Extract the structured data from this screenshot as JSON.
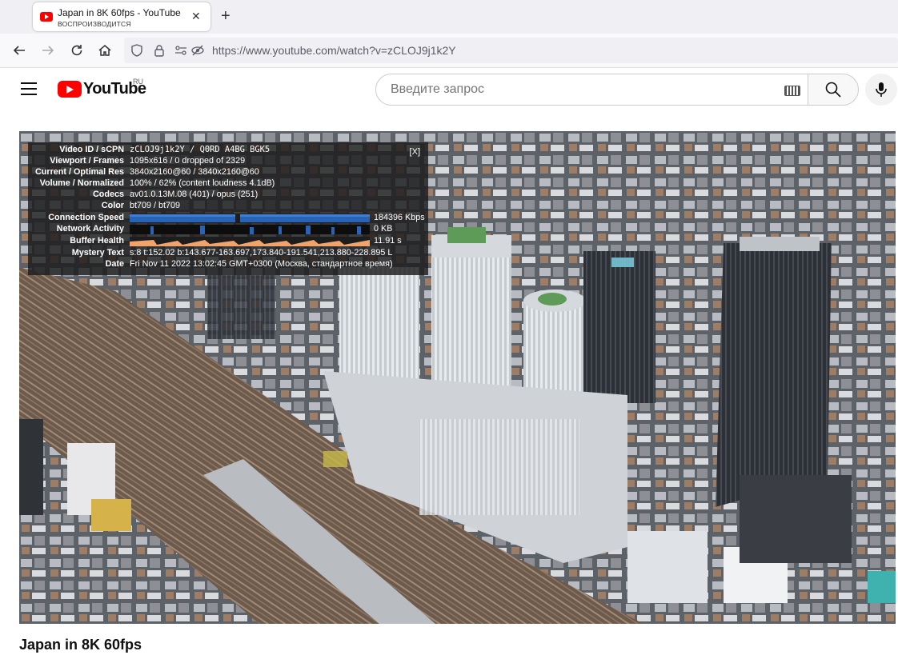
{
  "browser": {
    "tab_title": "Japan in 8K 60fps - YouTube",
    "tab_subtitle": "ВОСПРОИЗВОДИТСЯ",
    "url": "https://www.youtube.com/watch?v=zCLOJ9j1k2Y"
  },
  "youtube": {
    "logo_text": "YouTube",
    "country_code": "RU",
    "search_placeholder": "Введите запрос"
  },
  "stats": {
    "close_label": "[X]",
    "rows": [
      {
        "label": "Video ID / sCPN",
        "value": "zCLOJ9j1k2Y / Q0RD A4BG BGK5"
      },
      {
        "label": "Viewport / Frames",
        "value": "1095x616 / 0 dropped of 2329"
      },
      {
        "label": "Current / Optimal Res",
        "value": "3840x2160@60 / 3840x2160@60"
      },
      {
        "label": "Volume / Normalized",
        "value": "100% / 62% (content loudness 4.1dB)"
      },
      {
        "label": "Codecs",
        "value": "av01.0.13M.08 (401) / opus (251)"
      },
      {
        "label": "Color",
        "value": "bt709 / bt709"
      },
      {
        "label": "Connection Speed",
        "value": "184396 Kbps"
      },
      {
        "label": "Network Activity",
        "value": "0 KB"
      },
      {
        "label": "Buffer Health",
        "value": "11.91 s"
      },
      {
        "label": "Mystery Text",
        "value": "s:8 t:152.02 b:143.677-163.697,173.840-191.541,213.880-228.895 L"
      },
      {
        "label": "Date",
        "value": "Fri Nov 11 2022 13:02:45 GMT+0300 (Москва, стандартное время)"
      }
    ]
  },
  "video": {
    "title": "Japan in 8K 60fps"
  }
}
